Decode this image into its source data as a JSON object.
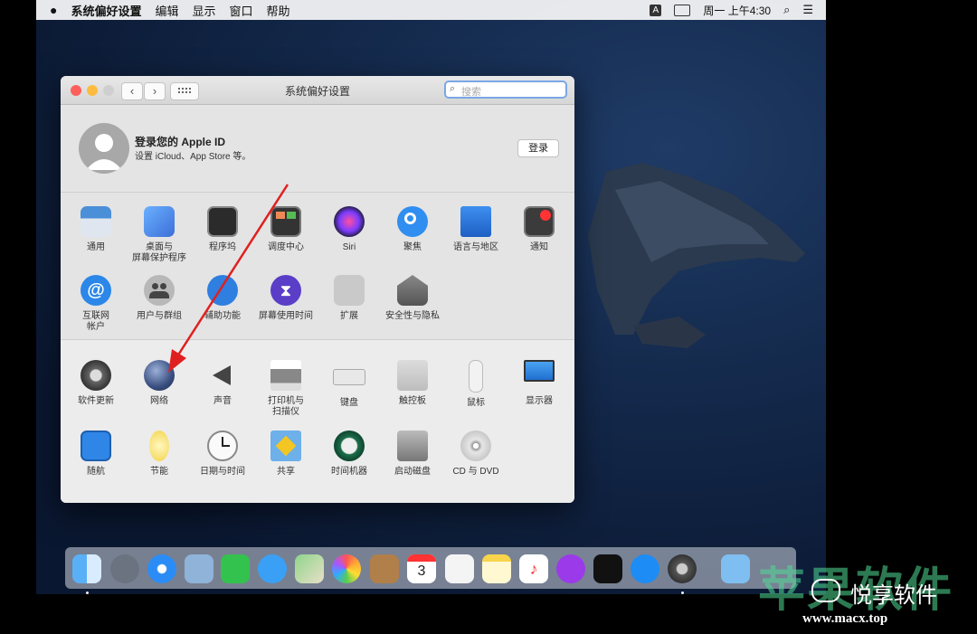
{
  "menubar": {
    "app": "系统偏好设置",
    "menus": [
      "编辑",
      "显示",
      "窗口",
      "帮助"
    ],
    "input_badge": "A",
    "clock": "周一 上午4:30"
  },
  "window": {
    "title": "系统偏好设置",
    "search_placeholder": "搜索"
  },
  "apple_id": {
    "title": "登录您的 Apple ID",
    "subtitle": "设置 iCloud、App Store 等。",
    "login_label": "登录"
  },
  "panes_row1": [
    {
      "label": "通用",
      "icon": "general-icon"
    },
    {
      "label": "桌面与\n屏幕保护程序",
      "icon": "desktop-icon"
    },
    {
      "label": "程序坞",
      "icon": "dock-icon"
    },
    {
      "label": "调度中心",
      "icon": "mission-control-icon"
    },
    {
      "label": "Siri",
      "icon": "siri-icon"
    },
    {
      "label": "聚焦",
      "icon": "spotlight-icon"
    },
    {
      "label": "语言与地区",
      "icon": "language-icon"
    },
    {
      "label": "通知",
      "icon": "notification-icon"
    }
  ],
  "panes_row2": [
    {
      "label": "互联网\n帐户",
      "icon": "internet-accounts-icon"
    },
    {
      "label": "用户与群组",
      "icon": "users-icon"
    },
    {
      "label": "辅助功能",
      "icon": "accessibility-icon"
    },
    {
      "label": "屏幕使用时间",
      "icon": "screen-time-icon"
    },
    {
      "label": "扩展",
      "icon": "extensions-icon"
    },
    {
      "label": "安全性与隐私",
      "icon": "security-icon"
    }
  ],
  "panes_row3": [
    {
      "label": "软件更新",
      "icon": "software-update-icon"
    },
    {
      "label": "网络",
      "icon": "network-icon"
    },
    {
      "label": "声音",
      "icon": "sound-icon"
    },
    {
      "label": "打印机与\n扫描仪",
      "icon": "printer-icon"
    },
    {
      "label": "键盘",
      "icon": "keyboard-icon"
    },
    {
      "label": "触控板",
      "icon": "trackpad-icon"
    },
    {
      "label": "鼠标",
      "icon": "mouse-icon"
    },
    {
      "label": "显示器",
      "icon": "display-icon"
    }
  ],
  "panes_row4": [
    {
      "label": "随航",
      "icon": "sidecar-icon"
    },
    {
      "label": "节能",
      "icon": "energy-saver-icon"
    },
    {
      "label": "日期与时间",
      "icon": "date-time-icon"
    },
    {
      "label": "共享",
      "icon": "sharing-icon"
    },
    {
      "label": "时间机器",
      "icon": "time-machine-icon"
    },
    {
      "label": "启动磁盘",
      "icon": "startup-disk-icon"
    },
    {
      "label": "CD 与 DVD",
      "icon": "cd-dvd-icon"
    }
  ],
  "dock": {
    "calendar_day": "3"
  },
  "watermark": {
    "big": "苹果软件",
    "name": "悦享软件",
    "url": "www.macx.top"
  },
  "colors": {
    "accent": "#1a73e8",
    "arrow": "#e02020",
    "close": "#fc605c",
    "minimize": "#fdbc40",
    "zoom": "#34c84a"
  }
}
